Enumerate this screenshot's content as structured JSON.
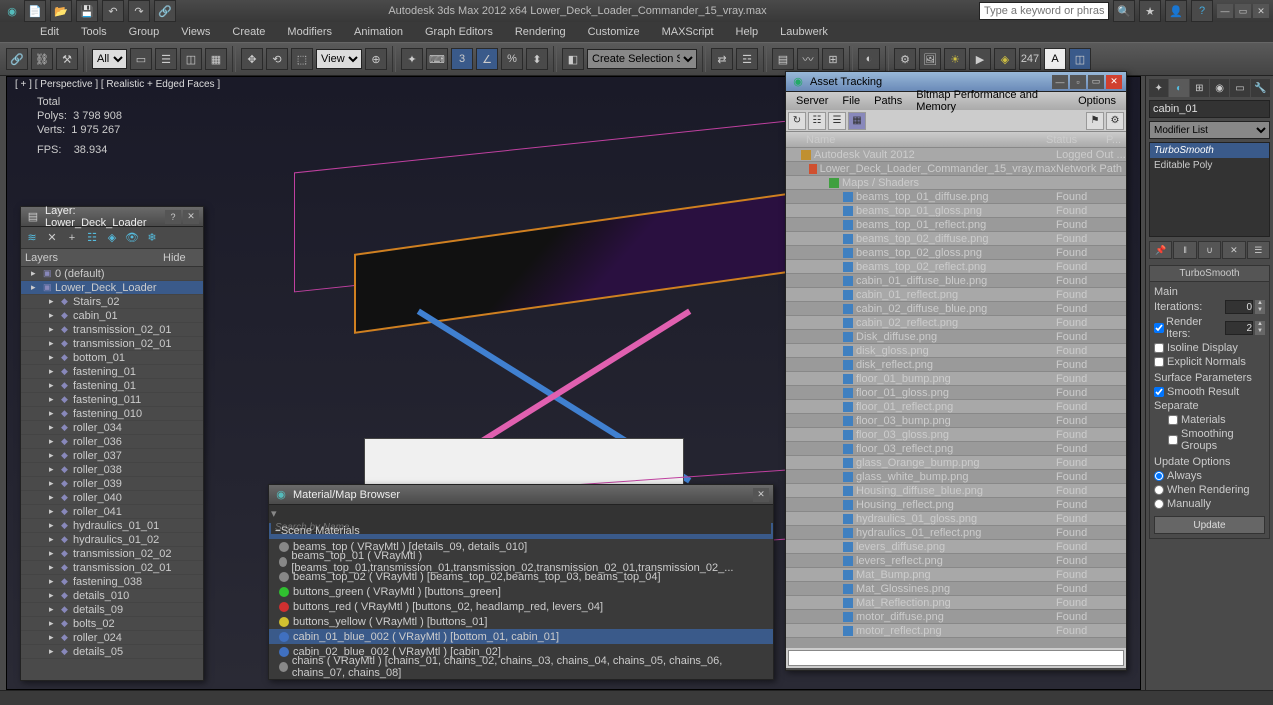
{
  "app": {
    "title": "Autodesk 3ds Max  2012 x64     Lower_Deck_Loader_Commander_15_vray.max",
    "search_placeholder": "Type a keyword or phrase"
  },
  "menu": [
    "Edit",
    "Tools",
    "Group",
    "Views",
    "Create",
    "Modifiers",
    "Animation",
    "Graph Editors",
    "Rendering",
    "Customize",
    "MAXScript",
    "Help",
    "Laubwerk"
  ],
  "toolbar": {
    "select_filter": "All",
    "view_mode": "View",
    "selection_set": "Create Selection Se",
    "polycount": "247"
  },
  "viewport": {
    "label": "[ + ]  [ Perspective ]  [ Realistic + Edged Faces ]",
    "stats": {
      "title": "Total",
      "polys_label": "Polys:",
      "polys": "3 798 908",
      "verts_label": "Verts:",
      "verts": "1 975 267",
      "fps_label": "FPS:",
      "fps": "38.934"
    }
  },
  "layer_panel": {
    "title": "Layer: Lower_Deck_Loader",
    "col_layers": "Layers",
    "col_hide": "Hide",
    "items": [
      {
        "name": "0 (default)",
        "depth": 0,
        "ic": "▣",
        "sel": false
      },
      {
        "name": "Lower_Deck_Loader",
        "depth": 0,
        "ic": "▣",
        "sel": true
      },
      {
        "name": "Stairs_02",
        "depth": 1,
        "ic": "◆",
        "sel": false
      },
      {
        "name": "cabin_01",
        "depth": 1,
        "ic": "◆",
        "sel": false
      },
      {
        "name": "transmission_02_01",
        "depth": 1,
        "ic": "◆",
        "sel": false
      },
      {
        "name": "transmission_02_01",
        "depth": 1,
        "ic": "◆",
        "sel": false
      },
      {
        "name": "bottom_01",
        "depth": 1,
        "ic": "◆",
        "sel": false
      },
      {
        "name": "fastening_01",
        "depth": 1,
        "ic": "◆",
        "sel": false
      },
      {
        "name": "fastening_01",
        "depth": 1,
        "ic": "◆",
        "sel": false
      },
      {
        "name": "fastening_011",
        "depth": 1,
        "ic": "◆",
        "sel": false
      },
      {
        "name": "fastening_010",
        "depth": 1,
        "ic": "◆",
        "sel": false
      },
      {
        "name": "roller_034",
        "depth": 1,
        "ic": "◆",
        "sel": false
      },
      {
        "name": "roller_036",
        "depth": 1,
        "ic": "◆",
        "sel": false
      },
      {
        "name": "roller_037",
        "depth": 1,
        "ic": "◆",
        "sel": false
      },
      {
        "name": "roller_038",
        "depth": 1,
        "ic": "◆",
        "sel": false
      },
      {
        "name": "roller_039",
        "depth": 1,
        "ic": "◆",
        "sel": false
      },
      {
        "name": "roller_040",
        "depth": 1,
        "ic": "◆",
        "sel": false
      },
      {
        "name": "roller_041",
        "depth": 1,
        "ic": "◆",
        "sel": false
      },
      {
        "name": "hydraulics_01_01",
        "depth": 1,
        "ic": "◆",
        "sel": false
      },
      {
        "name": "hydraulics_01_02",
        "depth": 1,
        "ic": "◆",
        "sel": false
      },
      {
        "name": "transmission_02_02",
        "depth": 1,
        "ic": "◆",
        "sel": false
      },
      {
        "name": "transmission_02_01",
        "depth": 1,
        "ic": "◆",
        "sel": false
      },
      {
        "name": "fastening_038",
        "depth": 1,
        "ic": "◆",
        "sel": false
      },
      {
        "name": "details_010",
        "depth": 1,
        "ic": "◆",
        "sel": false
      },
      {
        "name": "details_09",
        "depth": 1,
        "ic": "◆",
        "sel": false
      },
      {
        "name": "bolts_02",
        "depth": 1,
        "ic": "◆",
        "sel": false
      },
      {
        "name": "roller_024",
        "depth": 1,
        "ic": "◆",
        "sel": false
      },
      {
        "name": "details_05",
        "depth": 1,
        "ic": "◆",
        "sel": false
      }
    ]
  },
  "asset_panel": {
    "title": "Asset Tracking",
    "menu": [
      "Server",
      "File",
      "Paths",
      "Bitmap Performance and Memory",
      "Options"
    ],
    "col_name": "Name",
    "col_status": "Status",
    "col_p": "P...",
    "rows": [
      {
        "name": "Autodesk Vault 2012",
        "status": "Logged Out ...",
        "indent": 0,
        "ic": "#c09030"
      },
      {
        "name": "Lower_Deck_Loader_Commander_15_vray.max",
        "status": "Network Path",
        "indent": 1,
        "ic": "#d05030"
      },
      {
        "name": "Maps / Shaders",
        "status": "",
        "indent": 2,
        "ic": "#40a040"
      },
      {
        "name": "beams_top_01_diffuse.png",
        "status": "Found",
        "indent": 3,
        "ic": "#4080c0"
      },
      {
        "name": "beams_top_01_gloss.png",
        "status": "Found",
        "indent": 3,
        "ic": "#4080c0"
      },
      {
        "name": "beams_top_01_reflect.png",
        "status": "Found",
        "indent": 3,
        "ic": "#4080c0"
      },
      {
        "name": "beams_top_02_diffuse.png",
        "status": "Found",
        "indent": 3,
        "ic": "#4080c0"
      },
      {
        "name": "beams_top_02_gloss.png",
        "status": "Found",
        "indent": 3,
        "ic": "#4080c0"
      },
      {
        "name": "beams_top_02_reflect.png",
        "status": "Found",
        "indent": 3,
        "ic": "#4080c0"
      },
      {
        "name": "cabin_01_diffuse_blue.png",
        "status": "Found",
        "indent": 3,
        "ic": "#4080c0"
      },
      {
        "name": "cabin_01_reflect.png",
        "status": "Found",
        "indent": 3,
        "ic": "#4080c0"
      },
      {
        "name": "cabin_02_diffuse_blue.png",
        "status": "Found",
        "indent": 3,
        "ic": "#4080c0"
      },
      {
        "name": "cabin_02_reflect.png",
        "status": "Found",
        "indent": 3,
        "ic": "#4080c0"
      },
      {
        "name": "Disk_diffuse.png",
        "status": "Found",
        "indent": 3,
        "ic": "#4080c0"
      },
      {
        "name": "disk_gloss.png",
        "status": "Found",
        "indent": 3,
        "ic": "#4080c0"
      },
      {
        "name": "disk_reflect.png",
        "status": "Found",
        "indent": 3,
        "ic": "#4080c0"
      },
      {
        "name": "floor_01_bump.png",
        "status": "Found",
        "indent": 3,
        "ic": "#4080c0"
      },
      {
        "name": "floor_01_gloss.png",
        "status": "Found",
        "indent": 3,
        "ic": "#4080c0"
      },
      {
        "name": "floor_01_reflect.png",
        "status": "Found",
        "indent": 3,
        "ic": "#4080c0"
      },
      {
        "name": "floor_03_bump.png",
        "status": "Found",
        "indent": 3,
        "ic": "#4080c0"
      },
      {
        "name": "floor_03_gloss.png",
        "status": "Found",
        "indent": 3,
        "ic": "#4080c0"
      },
      {
        "name": "floor_03_reflect.png",
        "status": "Found",
        "indent": 3,
        "ic": "#4080c0"
      },
      {
        "name": "glass_Orange_bump.png",
        "status": "Found",
        "indent": 3,
        "ic": "#4080c0"
      },
      {
        "name": "glass_white_bump.png",
        "status": "Found",
        "indent": 3,
        "ic": "#4080c0"
      },
      {
        "name": "Housing_diffuse_blue.png",
        "status": "Found",
        "indent": 3,
        "ic": "#4080c0"
      },
      {
        "name": "Housing_reflect.png",
        "status": "Found",
        "indent": 3,
        "ic": "#4080c0"
      },
      {
        "name": "hydraulics_01_gloss.png",
        "status": "Found",
        "indent": 3,
        "ic": "#4080c0"
      },
      {
        "name": "hydraulics_01_reflect.png",
        "status": "Found",
        "indent": 3,
        "ic": "#4080c0"
      },
      {
        "name": "levers_diffuse.png",
        "status": "Found",
        "indent": 3,
        "ic": "#4080c0"
      },
      {
        "name": "levers_reflect.png",
        "status": "Found",
        "indent": 3,
        "ic": "#4080c0"
      },
      {
        "name": "Mat_Bump.png",
        "status": "Found",
        "indent": 3,
        "ic": "#4080c0"
      },
      {
        "name": "Mat_Glossines.png",
        "status": "Found",
        "indent": 3,
        "ic": "#4080c0"
      },
      {
        "name": "Mat_Reflection.png",
        "status": "Found",
        "indent": 3,
        "ic": "#4080c0"
      },
      {
        "name": "motor_diffuse.png",
        "status": "Found",
        "indent": 3,
        "ic": "#4080c0"
      },
      {
        "name": "motor_reflect.png",
        "status": "Found",
        "indent": 3,
        "ic": "#4080c0"
      }
    ]
  },
  "mat_panel": {
    "title": "Material/Map Browser",
    "search_placeholder": "Search by Name ...",
    "header": "Scene Materials",
    "rows": [
      {
        "name": "beams_top  ( VRayMtl )  [details_09, details_010]",
        "color": "#888",
        "sel": false
      },
      {
        "name": "beams_top_01  ( VRayMtl )  [beams_top_01,transmission_01,transmission_02,transmission_02_01,transmission_02_...",
        "color": "#888",
        "sel": false
      },
      {
        "name": "beams_top_02  ( VRayMtl )  [beams_top_02,beams_top_03, beams_top_04]",
        "color": "#888",
        "sel": false
      },
      {
        "name": "buttons_green  ( VRayMtl )  [buttons_green]",
        "color": "#30c030",
        "sel": false
      },
      {
        "name": "buttons_red  ( VRayMtl )  [buttons_02, headlamp_red, levers_04]",
        "color": "#d03030",
        "sel": false
      },
      {
        "name": "buttons_yellow  ( VRayMtl )  [buttons_01]",
        "color": "#d0c030",
        "sel": false
      },
      {
        "name": "cabin_01_blue_002  ( VRayMtl )  [bottom_01, cabin_01]",
        "color": "#4070c0",
        "sel": true
      },
      {
        "name": "cabin_02_blue_002  ( VRayMtl )  [cabin_02]",
        "color": "#4070c0",
        "sel": false
      },
      {
        "name": "chains  ( VRayMtl )  [chains_01, chains_02, chains_03, chains_04, chains_05, chains_06, chains_07, chains_08]",
        "color": "#888",
        "sel": false
      }
    ]
  },
  "right_panel": {
    "obj_name": "cabin_01",
    "modifier_list": "Modifier List",
    "stack": [
      {
        "name": "TurboSmooth",
        "sel": true
      },
      {
        "name": "Editable Poly",
        "sel": false
      }
    ],
    "rollout_name": "TurboSmooth",
    "main_label": "Main",
    "iterations_label": "Iterations:",
    "iterations": "0",
    "render_iters_label": "Render Iters:",
    "render_iters": "2",
    "render_iters_checked": true,
    "isoline_label": "Isoline Display",
    "explicit_label": "Explicit Normals",
    "surface_label": "Surface Parameters",
    "smooth_result_label": "Smooth Result",
    "smooth_result_checked": true,
    "separate_label": "Separate",
    "sep_materials": "Materials",
    "sep_smoothing": "Smoothing Groups",
    "update_label": "Update Options",
    "opt_always": "Always",
    "opt_rendering": "When Rendering",
    "opt_manually": "Manually",
    "update_btn": "Update"
  }
}
